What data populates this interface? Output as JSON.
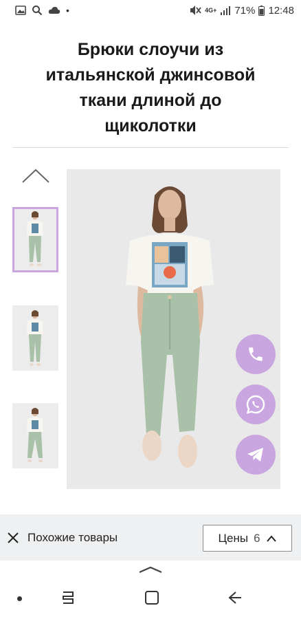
{
  "status_bar": {
    "network": "4G+",
    "battery": "71%",
    "time": "12:48"
  },
  "product": {
    "title": "Брюки слоучи из итальянской джинсовой ткани длиной до щиколотки"
  },
  "gallery": {
    "thumbnails": [
      {
        "label": "thumbnail-1",
        "selected": true
      },
      {
        "label": "thumbnail-2",
        "selected": false
      },
      {
        "label": "thumbnail-3",
        "selected": false
      }
    ]
  },
  "contact_buttons": [
    {
      "icon": "phone-icon"
    },
    {
      "icon": "whatsapp-icon"
    },
    {
      "icon": "telegram-icon"
    }
  ],
  "bottom_bar": {
    "similar_label": "Похожие товары",
    "prices_label": "Цены",
    "prices_count": "6"
  },
  "colors": {
    "accent": "#c9a6df",
    "pants": "#a9c1a8",
    "shirt": "#f7f5f0"
  }
}
